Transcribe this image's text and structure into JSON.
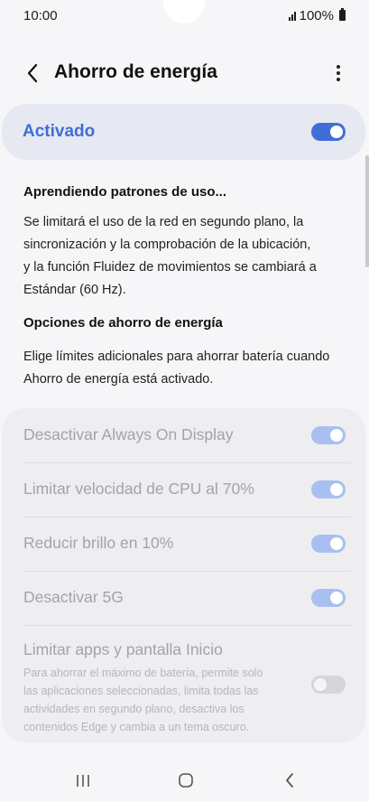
{
  "status_bar": {
    "time": "10:00",
    "battery": "100%"
  },
  "header": {
    "title": "Ahorro de energía",
    "back_icon": "chevron-left-icon",
    "more_icon": "more-vertical-icon"
  },
  "main_toggle": {
    "label": "Activado",
    "on": true
  },
  "learning": {
    "heading": "Aprendiendo patrones de uso...",
    "lines": [
      "Se limitará el uso de la red en segundo plano, la",
      "sincronización y la comprobación de la ubicación,",
      "y la función Fluidez de movimientos se cambiará a",
      "Estándar (60 Hz)."
    ]
  },
  "options_section": {
    "heading": "Opciones de ahorro de energía",
    "lines": [
      "Elige límites adicionales para ahorrar batería cuando",
      "Ahorro de energía está activado."
    ]
  },
  "options": [
    {
      "label": "Desactivar Always On Display",
      "on": true
    },
    {
      "label": "Limitar velocidad de CPU al 70%",
      "on": true
    },
    {
      "label": "Reducir brillo en 10%",
      "on": true
    },
    {
      "label": "Desactivar 5G",
      "on": true
    },
    {
      "label": "Limitar apps y pantalla Inicio",
      "on": false,
      "description_lines": [
        "Para ahorrar el máximo de batería, permite solo",
        "las aplicaciones seleccionadas, limita todas las",
        "actividades en segundo plano, desactiva los",
        "contenidos Edge y cambia a un tema oscuro."
      ]
    }
  ],
  "nav_bar": {
    "recents_icon": "recents-icon",
    "home_icon": "home-icon",
    "back_icon": "back-icon"
  },
  "colors": {
    "accent": "#3f6fd6",
    "accent_dim": "#a8bff0",
    "card_bg": "#e6e9f2",
    "options_bg": "#eeeef1",
    "disabled_text": "#a3a3a8"
  }
}
